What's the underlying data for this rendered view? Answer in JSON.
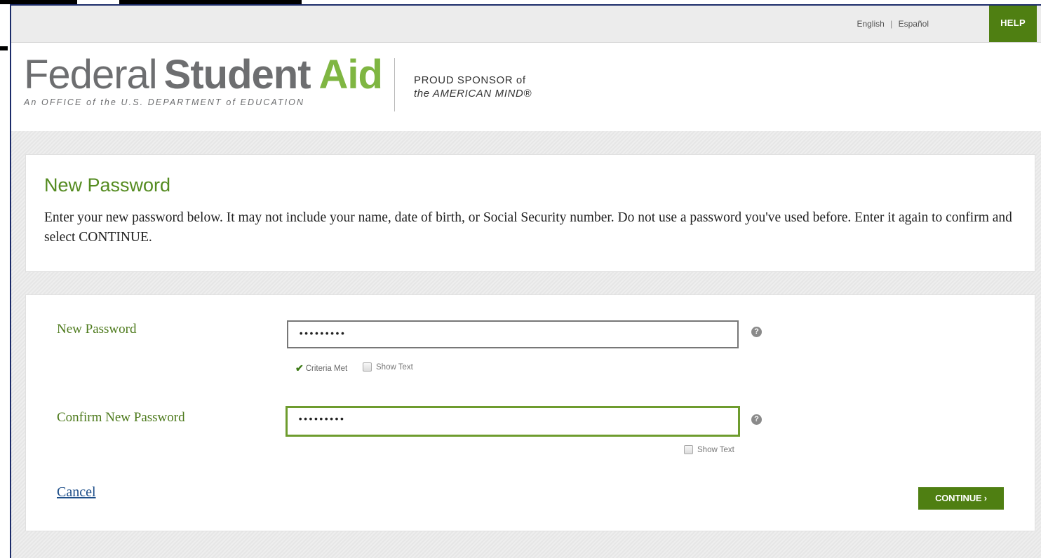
{
  "utility_bar": {
    "lang_english": "English",
    "lang_separator": "|",
    "lang_spanish": "Español",
    "help_label": "HELP"
  },
  "header": {
    "logo_federal": "Federal",
    "logo_student": "Student",
    "logo_aid": "Aid",
    "logo_subtitle": "An OFFICE of the U.S. DEPARTMENT of EDUCATION",
    "sponsor_line1": "PROUD SPONSOR of",
    "sponsor_line2": "the AMERICAN MIND®"
  },
  "intro": {
    "title": "New Password",
    "text": "Enter your new password below. It may not include your name, date of birth, or Social Security number. Do not use a password you've used before. Enter it again to confirm and select CONTINUE."
  },
  "form": {
    "new_password": {
      "label": "New Password",
      "value": "•••••••••",
      "criteria_text": "Criteria Met",
      "show_text_label": "Show Text"
    },
    "confirm_password": {
      "label": "Confirm New Password",
      "value": "•••••••••",
      "show_text_label": "Show Text"
    },
    "help_icon_glyph": "?",
    "cancel_label": "Cancel",
    "continue_label": "CONTINUE ›"
  },
  "colors": {
    "brand_green": "#4f7f12",
    "label_green": "#4d7a1c",
    "aid_green": "#7fb642",
    "link_blue": "#1d4e89"
  },
  "icons": {
    "help": "question-circle-icon",
    "check": "checkmark-icon"
  }
}
